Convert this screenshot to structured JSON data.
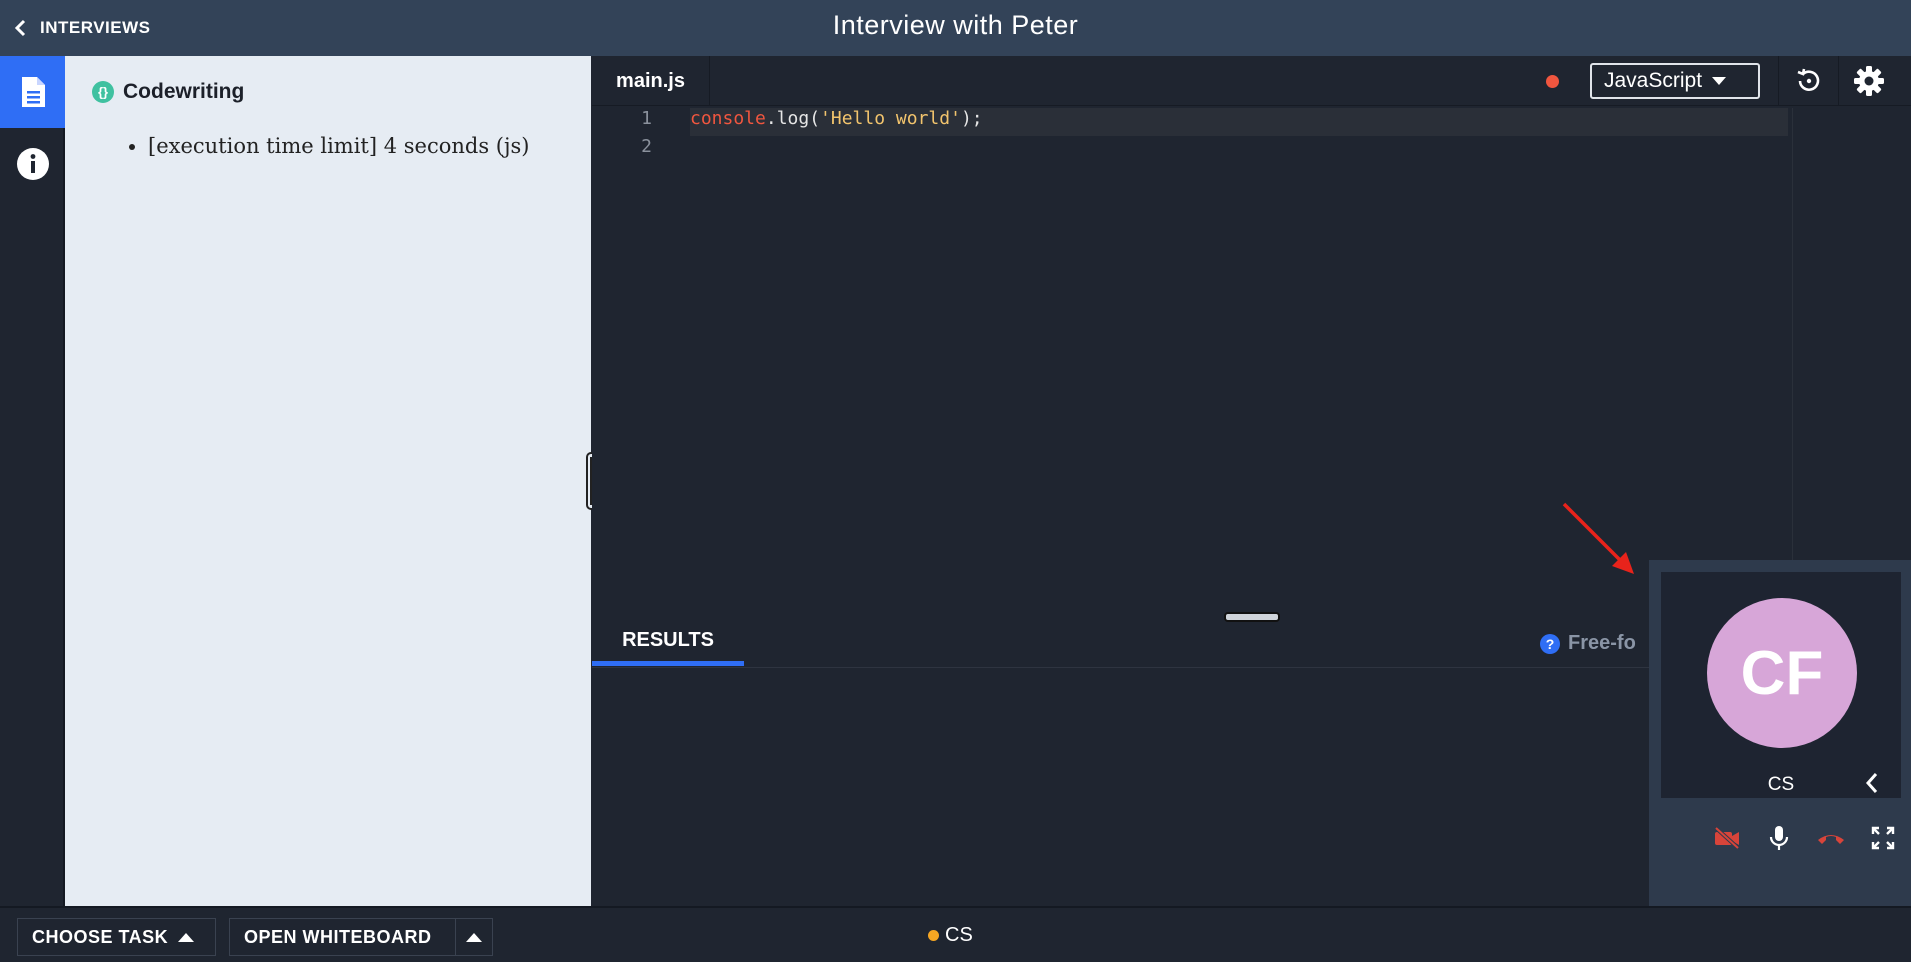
{
  "header": {
    "back_label": "INTERVIEWS",
    "title": "Interview with Peter"
  },
  "sidebar": {
    "items": [
      {
        "icon": "document-icon",
        "active": true
      },
      {
        "icon": "info-icon",
        "active": false
      }
    ]
  },
  "description": {
    "section_title": "Codewriting",
    "bullets": [
      "[execution time limit] 4 seconds (js)"
    ]
  },
  "editor": {
    "file_tab": "main.js",
    "language": "JavaScript",
    "lines": [
      {
        "number": "1",
        "obj": "console",
        "method": ".log(",
        "string": "'Hello world'",
        "tail": ");"
      },
      {
        "number": "2",
        "obj": "",
        "method": "",
        "string": "",
        "tail": ""
      }
    ]
  },
  "results": {
    "tab_label": "RESULTS",
    "freeform_label": "Free-fo"
  },
  "video": {
    "initials": "CF",
    "name": "CS",
    "avatar_color": "#d7a6d8"
  },
  "footer": {
    "choose_task_label": "CHOOSE TASK",
    "whiteboard_label": "OPEN WHITEBOARD",
    "presence_name": "CS"
  },
  "colors": {
    "accent": "#2f6ef5",
    "header_bg": "#334358",
    "unsaved_dot": "#f0563f",
    "annotation_arrow": "#e8231b"
  }
}
